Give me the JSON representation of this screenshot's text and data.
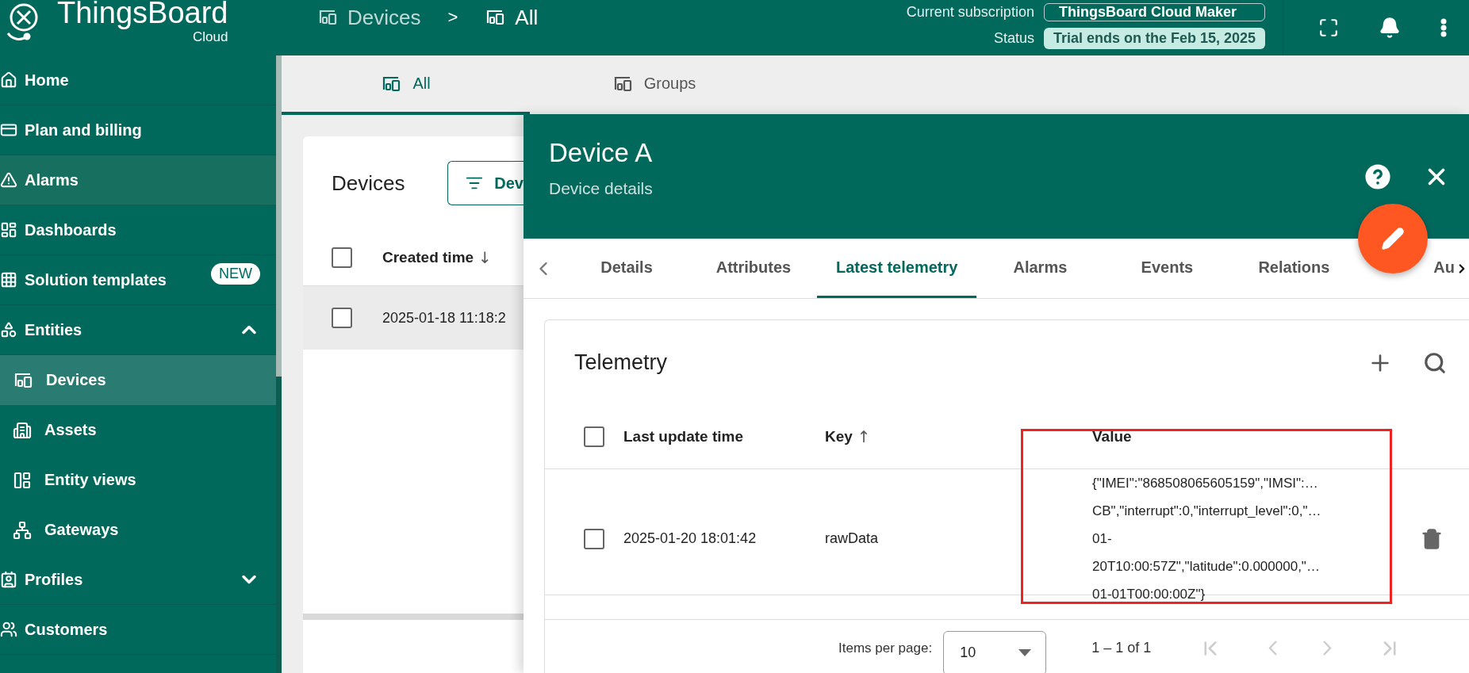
{
  "topbar": {
    "logo": {
      "name": "ThingsBoard",
      "sub": "Cloud"
    },
    "breadcrumb": [
      {
        "label": "Devices",
        "current": false
      },
      {
        "label": "All",
        "current": true
      }
    ],
    "separator": ">",
    "subscription": {
      "label": "Current subscription",
      "value": "ThingsBoard Cloud Maker"
    },
    "status": {
      "label": "Status",
      "value": "Trial ends on the Feb 15, 2025"
    }
  },
  "sidebar": {
    "items": [
      {
        "label": "Home",
        "selected": false,
        "highlighted": false
      },
      {
        "label": "Plan and billing",
        "selected": false,
        "highlighted": false
      },
      {
        "label": "Alarms",
        "selected": false,
        "highlighted": true
      },
      {
        "label": "Dashboards",
        "selected": false,
        "highlighted": false
      },
      {
        "label": "Solution templates",
        "selected": false,
        "highlighted": false,
        "badge": "NEW"
      },
      {
        "label": "Entities",
        "selected": false,
        "highlighted": false,
        "expanded": true,
        "children": [
          {
            "label": "Devices",
            "selected": true
          },
          {
            "label": "Assets",
            "selected": false
          },
          {
            "label": "Entity views",
            "selected": false
          },
          {
            "label": "Gateways",
            "selected": false
          }
        ]
      },
      {
        "label": "Profiles",
        "selected": false,
        "highlighted": false,
        "expanded": false
      },
      {
        "label": "Customers",
        "selected": false,
        "highlighted": false
      }
    ]
  },
  "tabs": [
    {
      "label": "All",
      "selected": true
    },
    {
      "label": "Groups",
      "selected": false
    }
  ],
  "devices_list": {
    "title": "Devices",
    "filter_button": "Dev",
    "header_checked": false,
    "columns": [
      {
        "label": "Created time",
        "sort_arrow": "↓"
      }
    ],
    "rows": [
      {
        "created_time": "2025-01-18 11:18:2",
        "checked": false,
        "highlighted": true
      }
    ]
  },
  "details": {
    "title": "Device A",
    "subtitle": "Device details",
    "tabs": [
      {
        "label": "Details",
        "selected": false
      },
      {
        "label": "Attributes",
        "selected": false
      },
      {
        "label": "Latest telemetry",
        "selected": true
      },
      {
        "label": "Alarms",
        "selected": false
      },
      {
        "label": "Events",
        "selected": false
      },
      {
        "label": "Relations",
        "selected": false
      },
      {
        "label": "Au",
        "selected": false
      }
    ],
    "telemetry": {
      "title": "Telemetry",
      "header_checked": false,
      "columns": [
        {
          "label": "Last update time"
        },
        {
          "label": "Key",
          "sort_arrow": "↑"
        },
        {
          "label": "Value"
        }
      ],
      "rows": [
        {
          "checked": false,
          "time": "2025-01-20 18:01:42",
          "key": "rawData",
          "value_lines": [
            "{\"IMEI\":\"868508065605159\",\"IMSI\":…",
            "CB\",\"interrupt\":0,\"interrupt_level\":0,\"…",
            "01-",
            "20T10:00:57Z\",\"latitude\":0.000000,\"…",
            "01-01T00:00:00Z\"}"
          ]
        }
      ],
      "pagination": {
        "label": "Items per page:",
        "page_size": "10",
        "range": "1 – 1 of 1"
      }
    }
  }
}
